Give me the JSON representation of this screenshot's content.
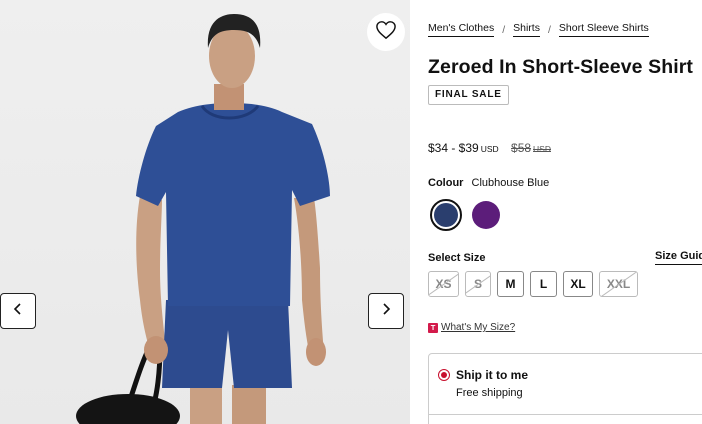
{
  "breadcrumb": [
    {
      "label": "Men's Clothes"
    },
    {
      "label": "Shirts"
    },
    {
      "label": "Short Sleeve Shirts"
    }
  ],
  "breadcrumb_separator": "/",
  "product": {
    "title": "Zeroed In Short-Sleeve Shirt",
    "badge": "FINAL SALE",
    "price": {
      "range": "$34 - $39",
      "currency": "USD",
      "original": "$58",
      "original_currency": "USD"
    },
    "colour": {
      "label": "Colour",
      "selected": "Clubhouse Blue",
      "swatches": [
        {
          "name": "Clubhouse Blue",
          "hex": "#2a3e6e",
          "selected": true
        },
        {
          "name": "purple",
          "hex": "#5c1d7a",
          "selected": false
        }
      ]
    },
    "size": {
      "label": "Select Size",
      "guide_label": "Size Guid",
      "options": [
        {
          "label": "XS",
          "available": false
        },
        {
          "label": "S",
          "available": false
        },
        {
          "label": "M",
          "available": true
        },
        {
          "label": "L",
          "available": true
        },
        {
          "label": "XL",
          "available": true
        },
        {
          "label": "XXL",
          "available": false
        }
      ],
      "whats_my_size_icon": "T",
      "whats_my_size": "What's My Size?"
    },
    "shipping": {
      "option_title": "Ship it to me",
      "option_subtitle": "Free shipping",
      "selected": true
    }
  },
  "icons": {
    "wishlist": "heart-icon",
    "prev": "chevron-left-icon",
    "next": "chevron-right-icon"
  },
  "colors": {
    "accent": "#c8102e",
    "brand_red": "#d31a4b",
    "shirt_blue": "#2a3e6e"
  }
}
